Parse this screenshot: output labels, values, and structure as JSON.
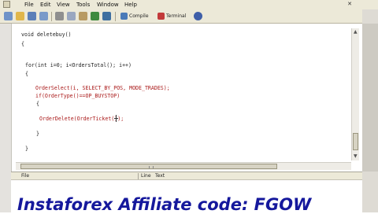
{
  "menu": {
    "items": [
      {
        "label": "File"
      },
      {
        "label": "Edit"
      },
      {
        "label": "View"
      },
      {
        "label": "Tools"
      },
      {
        "label": "Window"
      },
      {
        "label": "Help"
      }
    ],
    "close_glyph": "✕"
  },
  "toolbar": {
    "icons": [
      {
        "name": "new-file-icon",
        "color": "#6f93c8"
      },
      {
        "name": "open-folder-icon",
        "color": "#e0b64a"
      },
      {
        "name": "save-icon",
        "color": "#5b7fb8"
      },
      {
        "name": "save-all-icon",
        "color": "#7a9ac9"
      },
      {
        "name": "cut-icon",
        "color": "#8f8f8f"
      },
      {
        "name": "copy-icon",
        "color": "#9aa7c0"
      },
      {
        "name": "paste-icon",
        "color": "#b89a62"
      },
      {
        "name": "undo-icon",
        "color": "#3f8a3f"
      },
      {
        "name": "redo-icon",
        "color": "#3f6fa0"
      },
      {
        "name": "compile-icon",
        "color": "#4a7ab8"
      },
      {
        "name": "terminal-icon",
        "color": "#c23a3a"
      },
      {
        "name": "navigator-icon",
        "color": "#3f5fa8"
      }
    ],
    "compile_label": "Compile",
    "terminal_label": "Terminal"
  },
  "code": {
    "lines": [
      "void deletebuy()",
      "{",
      "for(int i=0; i<OrdersTotal(); i++)",
      "{",
      "OrderSelect(i, SELECT_BY_POS, MODE_TRADES);",
      "if(OrderType()==OP_BUYSTOP)",
      "{",
      "OrderDelete(OrderTicket());",
      "}",
      "}"
    ]
  },
  "panel": {
    "col_file": "File",
    "col_line": "Line",
    "col_text": "Text"
  },
  "banner": {
    "text": "Instaforex Affiliate code: FGOW"
  }
}
